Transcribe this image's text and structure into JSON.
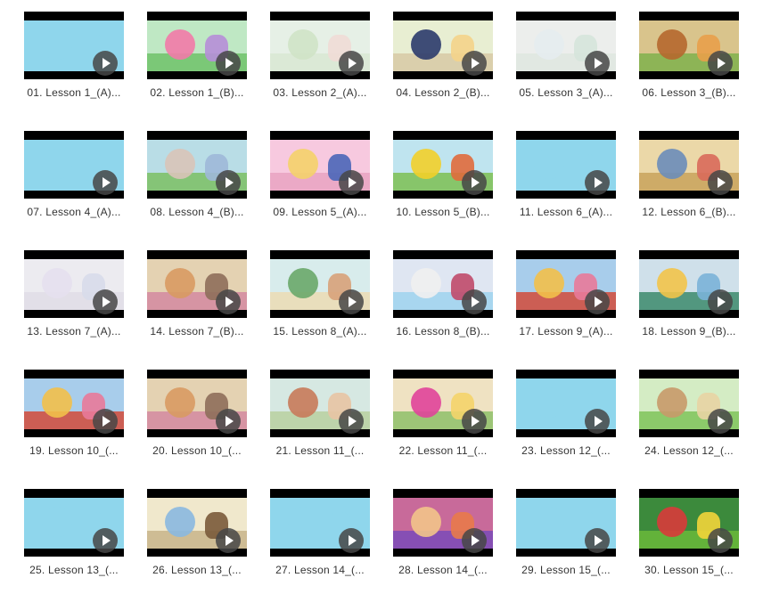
{
  "videos": [
    {
      "label": "01. Lesson 1_(A)...",
      "scene": "plain"
    },
    {
      "label": "02. Lesson 1_(B)...",
      "scene": "garden"
    },
    {
      "label": "03. Lesson 2_(A)...",
      "scene": "faded"
    },
    {
      "label": "04. Lesson 2_(B)...",
      "scene": "street"
    },
    {
      "label": "05. Lesson 3_(A)...",
      "scene": "faded-grey"
    },
    {
      "label": "06. Lesson 3_(B)...",
      "scene": "market"
    },
    {
      "label": "07. Lesson 4_(A)...",
      "scene": "plain"
    },
    {
      "label": "08. Lesson 4_(B)...",
      "scene": "park"
    },
    {
      "label": "09. Lesson 5_(A)...",
      "scene": "pink-room"
    },
    {
      "label": "10. Lesson 5_(B)...",
      "scene": "town"
    },
    {
      "label": "11. Lesson 6_(A)...",
      "scene": "plain"
    },
    {
      "label": "12. Lesson 6_(B)...",
      "scene": "room"
    },
    {
      "label": "13. Lesson 7_(A)...",
      "scene": "faded-room"
    },
    {
      "label": "14. Lesson 7_(B)...",
      "scene": "kitchen"
    },
    {
      "label": "15. Lesson 8_(A)...",
      "scene": "beach"
    },
    {
      "label": "16. Lesson 8_(B)...",
      "scene": "lab"
    },
    {
      "label": "17. Lesson 9_(A)...",
      "scene": "blue-room"
    },
    {
      "label": "18. Lesson 9_(B)...",
      "scene": "street2"
    },
    {
      "label": "19. Lesson 10_(...",
      "scene": "blue-room"
    },
    {
      "label": "20. Lesson 10_(...",
      "scene": "kitchen"
    },
    {
      "label": "21. Lesson 11_(...",
      "scene": "classroom"
    },
    {
      "label": "22. Lesson 11_(...",
      "scene": "yard"
    },
    {
      "label": "23. Lesson 12_(...",
      "scene": "plain"
    },
    {
      "label": "24. Lesson 12_(...",
      "scene": "garden2"
    },
    {
      "label": "25. Lesson 13_(...",
      "scene": "plain"
    },
    {
      "label": "26. Lesson 13_(...",
      "scene": "shop"
    },
    {
      "label": "27. Lesson 14_(...",
      "scene": "plain"
    },
    {
      "label": "28. Lesson 14_(...",
      "scene": "sunset"
    },
    {
      "label": "29. Lesson 15_(...",
      "scene": "plain"
    },
    {
      "label": "30. Lesson 15_(...",
      "scene": "forest"
    }
  ],
  "scenes": {
    "plain": {
      "bg": "#8fd6ec",
      "ground": "#8fd6ec",
      "a": "#8fd6ec",
      "b": "#8fd6ec"
    },
    "garden": {
      "bg": "#bfe8c4",
      "ground": "#6fc26a",
      "a": "#f27aa8",
      "b": "#b68ed8"
    },
    "faded": {
      "bg": "#e6f0e6",
      "ground": "#d8e8d2",
      "a": "#cfe3c6",
      "b": "#f0dcd6"
    },
    "street": {
      "bg": "#e8eed2",
      "ground": "#d7c9a6",
      "a": "#2b3a6b",
      "b": "#f4d38a"
    },
    "faded-grey": {
      "bg": "#eceeec",
      "ground": "#dfe6e0",
      "a": "#e6ecef",
      "b": "#d6e4dc"
    },
    "market": {
      "bg": "#d9c48c",
      "ground": "#7fb24c",
      "a": "#b5682e",
      "b": "#e8a04a"
    },
    "park": {
      "bg": "#b9dde6",
      "ground": "#7bbf63",
      "a": "#d9c4b8",
      "b": "#9fb8d8"
    },
    "pink-room": {
      "bg": "#f7c9df",
      "ground": "#e9a3c2",
      "a": "#f4d26a",
      "b": "#4a66b8"
    },
    "town": {
      "bg": "#bfe4ef",
      "ground": "#7cc052",
      "a": "#f2cf2a",
      "b": "#e06a3c"
    },
    "room": {
      "bg": "#ebd8a8",
      "ground": "#c9a35c",
      "a": "#6c8db9",
      "b": "#d96a5a"
    },
    "faded-room": {
      "bg": "#ecebf0",
      "ground": "#e0dde6",
      "a": "#e6e0ee",
      "b": "#d8dcea"
    },
    "kitchen": {
      "bg": "#e4d2b2",
      "ground": "#d38aa0",
      "a": "#d89a62",
      "b": "#8e6e5a"
    },
    "beach": {
      "bg": "#d8ecec",
      "ground": "#ecdcb4",
      "a": "#6aa86a",
      "b": "#d8a27a"
    },
    "lab": {
      "bg": "#dfe6f2",
      "ground": "#9fd2ee",
      "a": "#f0f0f0",
      "b": "#c04a6a"
    },
    "blue-room": {
      "bg": "#a8cdeb",
      "ground": "#d24a3a",
      "a": "#f2c04a",
      "b": "#e87a9a"
    },
    "street2": {
      "bg": "#cfe0ea",
      "ground": "#3c8a6c",
      "a": "#f2c44a",
      "b": "#7ab2d8"
    },
    "classroom": {
      "bg": "#d6e8e2",
      "ground": "#b8d0a0",
      "a": "#c87a5a",
      "b": "#e8c4a4"
    },
    "yard": {
      "bg": "#efe2c2",
      "ground": "#8ec06a",
      "a": "#e0449a",
      "b": "#f4d46a"
    },
    "garden2": {
      "bg": "#d4ecc4",
      "ground": "#7fc45a",
      "a": "#c89a6a",
      "b": "#e8d4a4"
    },
    "shop": {
      "bg": "#f0e8cc",
      "ground": "#c8b48a",
      "a": "#8ab8e0",
      "b": "#7a5a3a"
    },
    "sunset": {
      "bg": "#c86a9a",
      "ground": "#7a4ab8",
      "a": "#f2c48a",
      "b": "#e87a4a"
    },
    "forest": {
      "bg": "#3c8a3c",
      "ground": "#6ab83a",
      "a": "#d83a3a",
      "b": "#f2d43a"
    }
  }
}
